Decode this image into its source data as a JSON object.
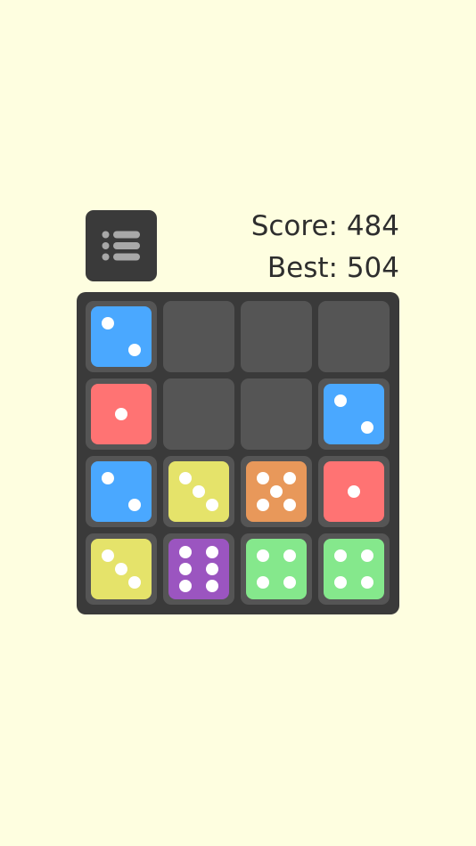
{
  "header": {
    "menu_icon": "list-icon",
    "score_text": "Score: 484",
    "best_text": "Best: 504"
  },
  "colors": {
    "background": "#fefee0",
    "board": "#3a3a3a",
    "empty_cell": "#555555",
    "pip": "#ffffff",
    "dice": {
      "1": "#ff7373",
      "2": "#4aa8ff",
      "3": "#e5e36a",
      "4": "#85e88c",
      "5": "#e8985a",
      "6": "#9b55c0"
    }
  },
  "board": {
    "rows": 4,
    "columns": 4,
    "cells": [
      [
        2,
        0,
        0,
        0
      ],
      [
        1,
        0,
        0,
        2
      ],
      [
        2,
        3,
        5,
        1
      ],
      [
        3,
        6,
        4,
        4
      ]
    ]
  }
}
